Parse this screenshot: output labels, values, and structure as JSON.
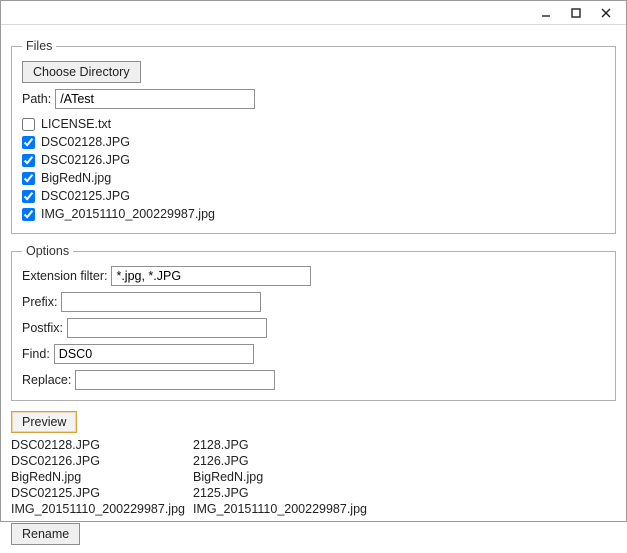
{
  "titlebar": {
    "minimize_icon": "minimize-icon",
    "maximize_icon": "maximize-icon",
    "close_icon": "close-icon"
  },
  "files": {
    "legend": "Files",
    "choose_directory_label": "Choose Directory",
    "path_label": "Path:",
    "path_value": "/ATest",
    "items": [
      {
        "name": "LICENSE.txt",
        "checked": false
      },
      {
        "name": "DSC02128.JPG",
        "checked": true
      },
      {
        "name": "DSC02126.JPG",
        "checked": true
      },
      {
        "name": "BigRedN.jpg",
        "checked": true
      },
      {
        "name": "DSC02125.JPG",
        "checked": true
      },
      {
        "name": "IMG_20151110_200229987.jpg",
        "checked": true
      }
    ]
  },
  "options": {
    "legend": "Options",
    "extension_filter_label": "Extension filter:",
    "extension_filter_value": "*.jpg, *.JPG",
    "prefix_label": "Prefix:",
    "prefix_value": "",
    "postfix_label": "Postfix:",
    "postfix_value": "",
    "find_label": "Find:",
    "find_value": "DSC0",
    "replace_label": "Replace:",
    "replace_value": ""
  },
  "actions": {
    "preview_label": "Preview",
    "rename_label": "Rename"
  },
  "preview": [
    {
      "from": "DSC02128.JPG",
      "to": "2128.JPG"
    },
    {
      "from": "DSC02126.JPG",
      "to": "2126.JPG"
    },
    {
      "from": "BigRedN.jpg",
      "to": "BigRedN.jpg"
    },
    {
      "from": "DSC02125.JPG",
      "to": "2125.JPG"
    },
    {
      "from": "IMG_20151110_200229987.jpg",
      "to": "IMG_20151110_200229987.jpg"
    }
  ]
}
